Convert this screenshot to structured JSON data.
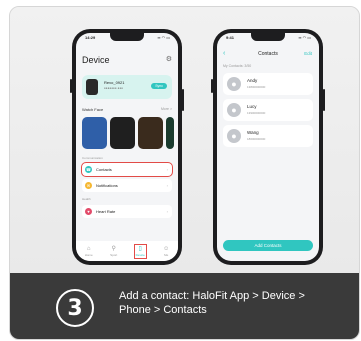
{
  "step": {
    "number": "3",
    "text": "Add a contact: HaloFit App > Device > Phone > Contacts"
  },
  "left_phone": {
    "time": "14:29",
    "status": "▪▪ ◠ ▭",
    "title": "Device",
    "gear_icon": "gear-icon",
    "device_name": "Revo_0921",
    "device_sub": "●●●●●●●  ●●●",
    "sync_label": "Sync",
    "watch_face_label": "Watch Face",
    "watch_face_more": "More >",
    "faces": [
      {
        "color": "#2f5fa8"
      },
      {
        "color": "#1f1f1f"
      },
      {
        "color": "#3a2b1d"
      },
      {
        "color": "#1a3b2e"
      }
    ],
    "section1": "Communication",
    "contacts_label": "Contacts",
    "notifications_label": "Notifications",
    "section2": "Health",
    "heart_rate_label": "Heart Rate",
    "tabs": [
      {
        "label": "Home",
        "icon": "⌂"
      },
      {
        "label": "Sport",
        "icon": "⚲"
      },
      {
        "label": "Device",
        "icon": "▯"
      },
      {
        "label": "Me",
        "icon": "☺"
      }
    ]
  },
  "right_phone": {
    "time": "9:41",
    "status": "▪▪ ◠ ▭",
    "back_icon": "chevron-left-icon",
    "title": "Contacts",
    "edit_label": "Edit",
    "count_label": "My Contacts: 3/50",
    "contacts": [
      {
        "name": "Andy",
        "number": "13800000000"
      },
      {
        "name": "Lucy",
        "number": "13900000000"
      },
      {
        "name": "Wang",
        "number": "18600000000"
      }
    ],
    "add_button": "Add Contacts"
  },
  "colors": {
    "accent": "#30c6c0",
    "highlight": "#e24b47",
    "band": "#3a3a3a"
  }
}
